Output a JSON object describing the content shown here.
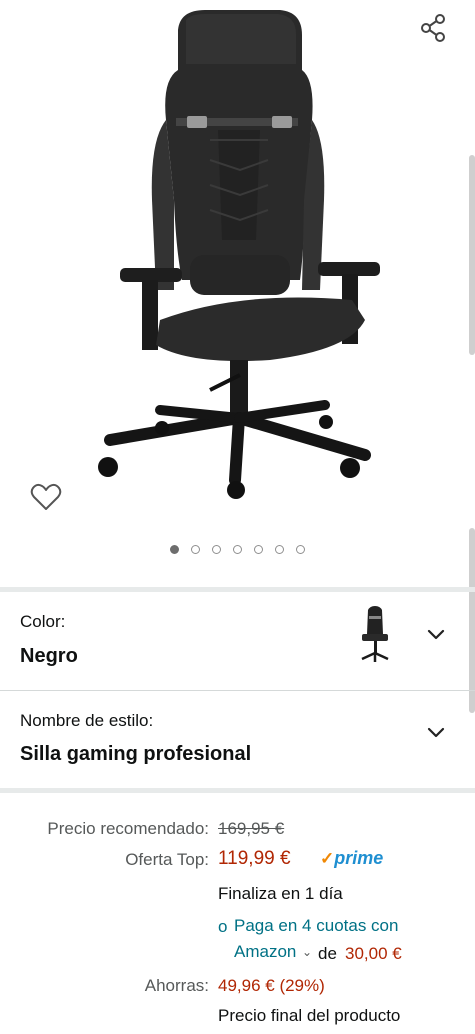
{
  "gallery": {
    "image_alt": "Silla gaming negra",
    "dot_count": 7,
    "active_dot": 0,
    "share_icon": "share-icon",
    "wishlist_icon": "heart-outline-icon"
  },
  "options": {
    "color": {
      "label": "Color:",
      "value": "Negro"
    },
    "style": {
      "label": "Nombre de estilo:",
      "value": "Silla gaming profesional"
    }
  },
  "pricing": {
    "recommended_label": "Precio recomendado:",
    "recommended_price": "169,95 €",
    "deal_label": "Oferta Top:",
    "deal_price": "119,99 €",
    "prime_label": "prime",
    "ends": "Finaliza en 1 día",
    "installments_prefix": "o",
    "installments_link": "Paga en 4 cuotas con Amazon",
    "installments_de": "de",
    "installments_amount": "30,00 €",
    "savings_label": "Ahorras:",
    "savings_value": "49,96 € (29%)",
    "final_price_note": "Precio final del producto"
  },
  "colors": {
    "red": "#b12704",
    "teal": "#007185",
    "prime": "#1f8fd1"
  }
}
